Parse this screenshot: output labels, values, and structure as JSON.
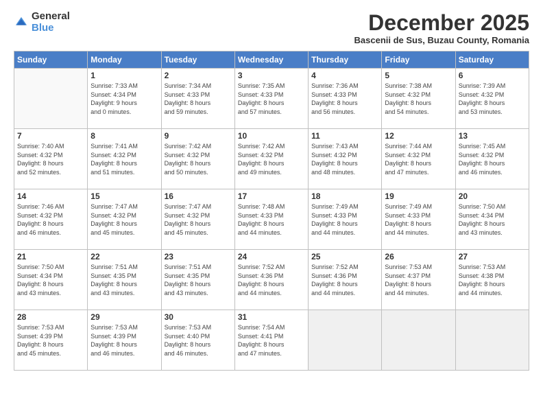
{
  "logo": {
    "general": "General",
    "blue": "Blue"
  },
  "header": {
    "month_title": "December 2025",
    "subtitle": "Bascenii de Sus, Buzau County, Romania"
  },
  "days_of_week": [
    "Sunday",
    "Monday",
    "Tuesday",
    "Wednesday",
    "Thursday",
    "Friday",
    "Saturday"
  ],
  "weeks": [
    [
      {
        "day": "",
        "info": ""
      },
      {
        "day": "1",
        "info": "Sunrise: 7:33 AM\nSunset: 4:34 PM\nDaylight: 9 hours\nand 0 minutes."
      },
      {
        "day": "2",
        "info": "Sunrise: 7:34 AM\nSunset: 4:33 PM\nDaylight: 8 hours\nand 59 minutes."
      },
      {
        "day": "3",
        "info": "Sunrise: 7:35 AM\nSunset: 4:33 PM\nDaylight: 8 hours\nand 57 minutes."
      },
      {
        "day": "4",
        "info": "Sunrise: 7:36 AM\nSunset: 4:33 PM\nDaylight: 8 hours\nand 56 minutes."
      },
      {
        "day": "5",
        "info": "Sunrise: 7:38 AM\nSunset: 4:32 PM\nDaylight: 8 hours\nand 54 minutes."
      },
      {
        "day": "6",
        "info": "Sunrise: 7:39 AM\nSunset: 4:32 PM\nDaylight: 8 hours\nand 53 minutes."
      }
    ],
    [
      {
        "day": "7",
        "info": "Sunrise: 7:40 AM\nSunset: 4:32 PM\nDaylight: 8 hours\nand 52 minutes."
      },
      {
        "day": "8",
        "info": "Sunrise: 7:41 AM\nSunset: 4:32 PM\nDaylight: 8 hours\nand 51 minutes."
      },
      {
        "day": "9",
        "info": "Sunrise: 7:42 AM\nSunset: 4:32 PM\nDaylight: 8 hours\nand 50 minutes."
      },
      {
        "day": "10",
        "info": "Sunrise: 7:42 AM\nSunset: 4:32 PM\nDaylight: 8 hours\nand 49 minutes."
      },
      {
        "day": "11",
        "info": "Sunrise: 7:43 AM\nSunset: 4:32 PM\nDaylight: 8 hours\nand 48 minutes."
      },
      {
        "day": "12",
        "info": "Sunrise: 7:44 AM\nSunset: 4:32 PM\nDaylight: 8 hours\nand 47 minutes."
      },
      {
        "day": "13",
        "info": "Sunrise: 7:45 AM\nSunset: 4:32 PM\nDaylight: 8 hours\nand 46 minutes."
      }
    ],
    [
      {
        "day": "14",
        "info": "Sunrise: 7:46 AM\nSunset: 4:32 PM\nDaylight: 8 hours\nand 46 minutes."
      },
      {
        "day": "15",
        "info": "Sunrise: 7:47 AM\nSunset: 4:32 PM\nDaylight: 8 hours\nand 45 minutes."
      },
      {
        "day": "16",
        "info": "Sunrise: 7:47 AM\nSunset: 4:32 PM\nDaylight: 8 hours\nand 45 minutes."
      },
      {
        "day": "17",
        "info": "Sunrise: 7:48 AM\nSunset: 4:33 PM\nDaylight: 8 hours\nand 44 minutes."
      },
      {
        "day": "18",
        "info": "Sunrise: 7:49 AM\nSunset: 4:33 PM\nDaylight: 8 hours\nand 44 minutes."
      },
      {
        "day": "19",
        "info": "Sunrise: 7:49 AM\nSunset: 4:33 PM\nDaylight: 8 hours\nand 44 minutes."
      },
      {
        "day": "20",
        "info": "Sunrise: 7:50 AM\nSunset: 4:34 PM\nDaylight: 8 hours\nand 43 minutes."
      }
    ],
    [
      {
        "day": "21",
        "info": "Sunrise: 7:50 AM\nSunset: 4:34 PM\nDaylight: 8 hours\nand 43 minutes."
      },
      {
        "day": "22",
        "info": "Sunrise: 7:51 AM\nSunset: 4:35 PM\nDaylight: 8 hours\nand 43 minutes."
      },
      {
        "day": "23",
        "info": "Sunrise: 7:51 AM\nSunset: 4:35 PM\nDaylight: 8 hours\nand 43 minutes."
      },
      {
        "day": "24",
        "info": "Sunrise: 7:52 AM\nSunset: 4:36 PM\nDaylight: 8 hours\nand 44 minutes."
      },
      {
        "day": "25",
        "info": "Sunrise: 7:52 AM\nSunset: 4:36 PM\nDaylight: 8 hours\nand 44 minutes."
      },
      {
        "day": "26",
        "info": "Sunrise: 7:53 AM\nSunset: 4:37 PM\nDaylight: 8 hours\nand 44 minutes."
      },
      {
        "day": "27",
        "info": "Sunrise: 7:53 AM\nSunset: 4:38 PM\nDaylight: 8 hours\nand 44 minutes."
      }
    ],
    [
      {
        "day": "28",
        "info": "Sunrise: 7:53 AM\nSunset: 4:39 PM\nDaylight: 8 hours\nand 45 minutes."
      },
      {
        "day": "29",
        "info": "Sunrise: 7:53 AM\nSunset: 4:39 PM\nDaylight: 8 hours\nand 46 minutes."
      },
      {
        "day": "30",
        "info": "Sunrise: 7:53 AM\nSunset: 4:40 PM\nDaylight: 8 hours\nand 46 minutes."
      },
      {
        "day": "31",
        "info": "Sunrise: 7:54 AM\nSunset: 4:41 PM\nDaylight: 8 hours\nand 47 minutes."
      },
      {
        "day": "",
        "info": ""
      },
      {
        "day": "",
        "info": ""
      },
      {
        "day": "",
        "info": ""
      }
    ]
  ]
}
